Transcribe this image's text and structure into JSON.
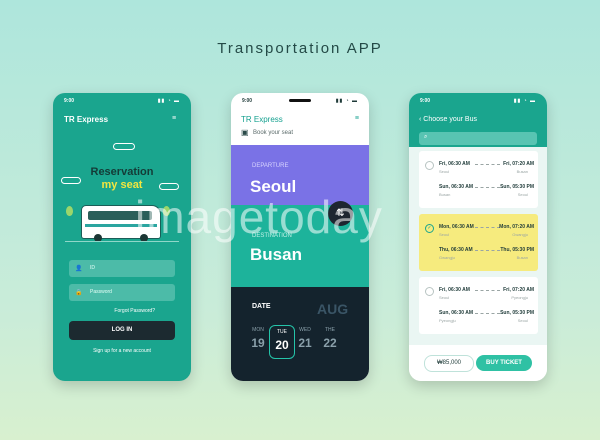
{
  "page_title": "Transportation APP",
  "watermark": "imagetoday",
  "login_screen": {
    "status_time": "9:00",
    "status_icons": "▮▮ ◔ ▬",
    "app_name": "TR Express",
    "headline_line1": "Reservation",
    "headline_line2": "my seat",
    "id_placeholder": "ID",
    "password_placeholder": "Password",
    "forgot_password": "Forgot Password?",
    "login_button": "LOG IN",
    "signup_link": "Sign up for a new account",
    "colors": {
      "background": "#1aa58e",
      "highlight": "#f2e640",
      "button": "#1c2a30"
    }
  },
  "booking_screen": {
    "status_time": "9:00",
    "status_icons": "▮▮ ◔ ▬",
    "app_name": "TR Express",
    "subtitle": "Book your seat",
    "departure_label": "DEPARTURE",
    "departure_city": "Seoul",
    "destination_label": "DESTINATION",
    "destination_city": "Busan",
    "swap_icon": "⇅",
    "date_label": "DATE",
    "month": "AUG",
    "days": [
      {
        "weekday": "MON",
        "date": "19"
      },
      {
        "weekday": "TUE",
        "date": "20",
        "selected": true
      },
      {
        "weekday": "WED",
        "date": "21"
      },
      {
        "weekday": "THE",
        "date": "22"
      }
    ],
    "colors": {
      "departure": "#7a72e6",
      "destination": "#1db39b",
      "date": "#14232d"
    }
  },
  "bus_list_screen": {
    "status_time": "9:00",
    "status_icons": "▮▮ ◔ ▬",
    "header": "Choose your Bus",
    "search_icon": "⌕",
    "buses": [
      {
        "selected": false,
        "trips": [
          {
            "depart": "Fri, 06:30 AM",
            "from": "Seoul",
            "arrive": "Fri, 07:20 AM",
            "to": "Busan"
          },
          {
            "depart": "Sun, 06:30 AM",
            "from": "Busan",
            "arrive": "Sun, 05:30 PM",
            "to": "Seoul"
          }
        ]
      },
      {
        "selected": true,
        "trips": [
          {
            "depart": "Mon, 06:30 AM",
            "from": "Seoul",
            "arrive": "Mon, 07:20 AM",
            "to": "Gwangju"
          },
          {
            "depart": "Thu, 06:30 AM",
            "from": "Gwangju",
            "arrive": "Thu, 05:30 PM",
            "to": "Busan"
          }
        ]
      },
      {
        "selected": false,
        "trips": [
          {
            "depart": "Fri, 06:30 AM",
            "from": "Seoul",
            "arrive": "Fri, 07:20 AM",
            "to": "Pyeongju"
          },
          {
            "depart": "Sun, 06:30 AM",
            "from": "Pyeongju",
            "arrive": "Sun, 05:30 PM",
            "to": "Seoul"
          }
        ]
      }
    ],
    "price": "₩85,000",
    "buy_button": "BUY TICKET",
    "colors": {
      "header": "#1aa58e",
      "selected_card": "#f6eb7e",
      "buy": "#2fc1a4"
    }
  }
}
